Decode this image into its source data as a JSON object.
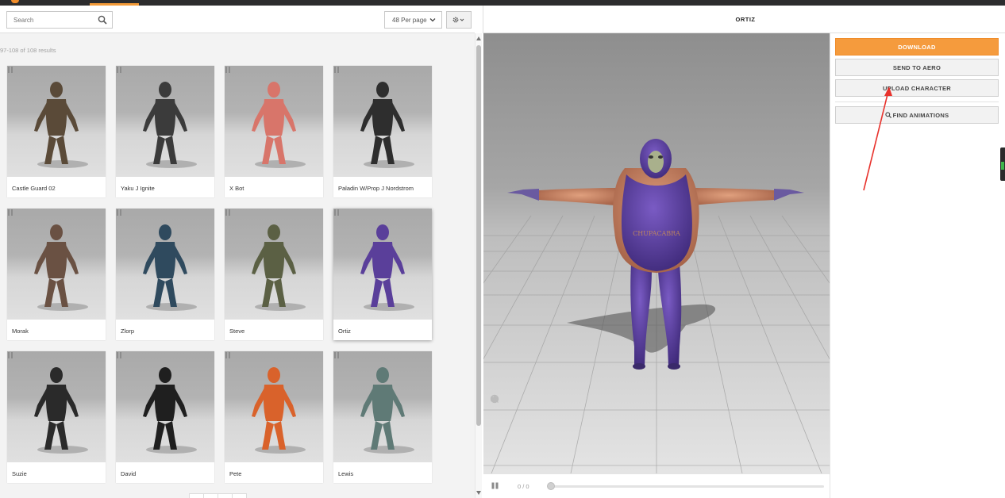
{
  "search": {
    "placeholder": "Search"
  },
  "toolbar": {
    "per_page": "48 Per page"
  },
  "results_text": "97-108 of 108 results",
  "characters": [
    {
      "name": "Castle Guard 02",
      "color": "#5a4a38"
    },
    {
      "name": "Yaku J Ignite",
      "color": "#3b3b3b"
    },
    {
      "name": "X Bot",
      "color": "#d8756a"
    },
    {
      "name": "Paladin W/Prop J Nordstrom",
      "color": "#2e2e2e"
    },
    {
      "name": "Morak",
      "color": "#6a5143"
    },
    {
      "name": "Zlorp",
      "color": "#2f4a5e"
    },
    {
      "name": "Steve",
      "color": "#5b6044"
    },
    {
      "name": "Ortiz",
      "color": "#5a3f9a"
    },
    {
      "name": "Suzie",
      "color": "#2a2a2a"
    },
    {
      "name": "David",
      "color": "#1f1f1f"
    },
    {
      "name": "Pete",
      "color": "#d9622b"
    },
    {
      "name": "Lewis",
      "color": "#5f7a76"
    }
  ],
  "viewer": {
    "title": "ORTIZ",
    "frame_counter": "0 / 0",
    "character_color": "#5c3fa0"
  },
  "actions": {
    "download": "DOWNLOAD",
    "send_to_aero": "SEND TO AERO",
    "upload_character": "UPLOAD CHARACTER",
    "find_animations": "FIND ANIMATIONS"
  },
  "colors": {
    "accent": "#f59b3d",
    "annotation_arrow": "#e8322c"
  }
}
